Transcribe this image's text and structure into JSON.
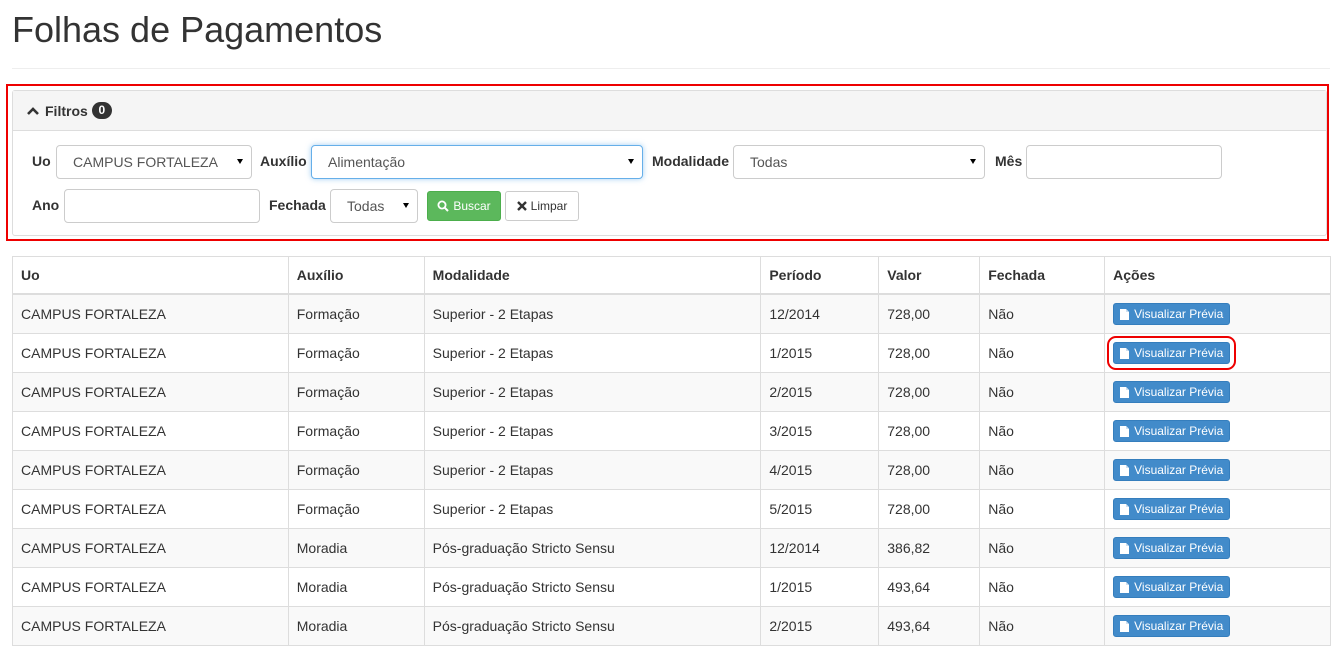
{
  "page": {
    "title": "Folhas de Pagamentos"
  },
  "filters": {
    "heading": "Filtros",
    "badge_count": "0",
    "uo": {
      "label": "Uo",
      "value": "CAMPUS FORTALEZA"
    },
    "auxilio": {
      "label": "Auxílio",
      "value": "Alimentação"
    },
    "modalidade": {
      "label": "Modalidade",
      "value": "Todas"
    },
    "mes": {
      "label": "Mês",
      "value": ""
    },
    "ano": {
      "label": "Ano",
      "value": ""
    },
    "fechada": {
      "label": "Fechada",
      "value": "Todas"
    },
    "buscar_label": "Buscar",
    "limpar_label": "Limpar"
  },
  "table": {
    "headers": [
      "Uo",
      "Auxílio",
      "Modalidade",
      "Período",
      "Valor",
      "Fechada",
      "Ações"
    ],
    "action_label": "Visualizar Prévia",
    "rows": [
      [
        "CAMPUS FORTALEZA",
        "Formação",
        "Superior - 2 Etapas",
        "12/2014",
        "728,00",
        "Não"
      ],
      [
        "CAMPUS FORTALEZA",
        "Formação",
        "Superior - 2 Etapas",
        "1/2015",
        "728,00",
        "Não"
      ],
      [
        "CAMPUS FORTALEZA",
        "Formação",
        "Superior - 2 Etapas",
        "2/2015",
        "728,00",
        "Não"
      ],
      [
        "CAMPUS FORTALEZA",
        "Formação",
        "Superior - 2 Etapas",
        "3/2015",
        "728,00",
        "Não"
      ],
      [
        "CAMPUS FORTALEZA",
        "Formação",
        "Superior - 2 Etapas",
        "4/2015",
        "728,00",
        "Não"
      ],
      [
        "CAMPUS FORTALEZA",
        "Formação",
        "Superior - 2 Etapas",
        "5/2015",
        "728,00",
        "Não"
      ],
      [
        "CAMPUS FORTALEZA",
        "Moradia",
        "Pós-graduação Stricto Sensu",
        "12/2014",
        "386,82",
        "Não"
      ],
      [
        "CAMPUS FORTALEZA",
        "Moradia",
        "Pós-graduação Stricto Sensu",
        "1/2015",
        "493,64",
        "Não"
      ],
      [
        "CAMPUS FORTALEZA",
        "Moradia",
        "Pós-graduação Stricto Sensu",
        "2/2015",
        "493,64",
        "Não"
      ]
    ]
  },
  "colors": {
    "success": "#5cb85c",
    "info": "#428bca",
    "highlight": "#e00000"
  }
}
